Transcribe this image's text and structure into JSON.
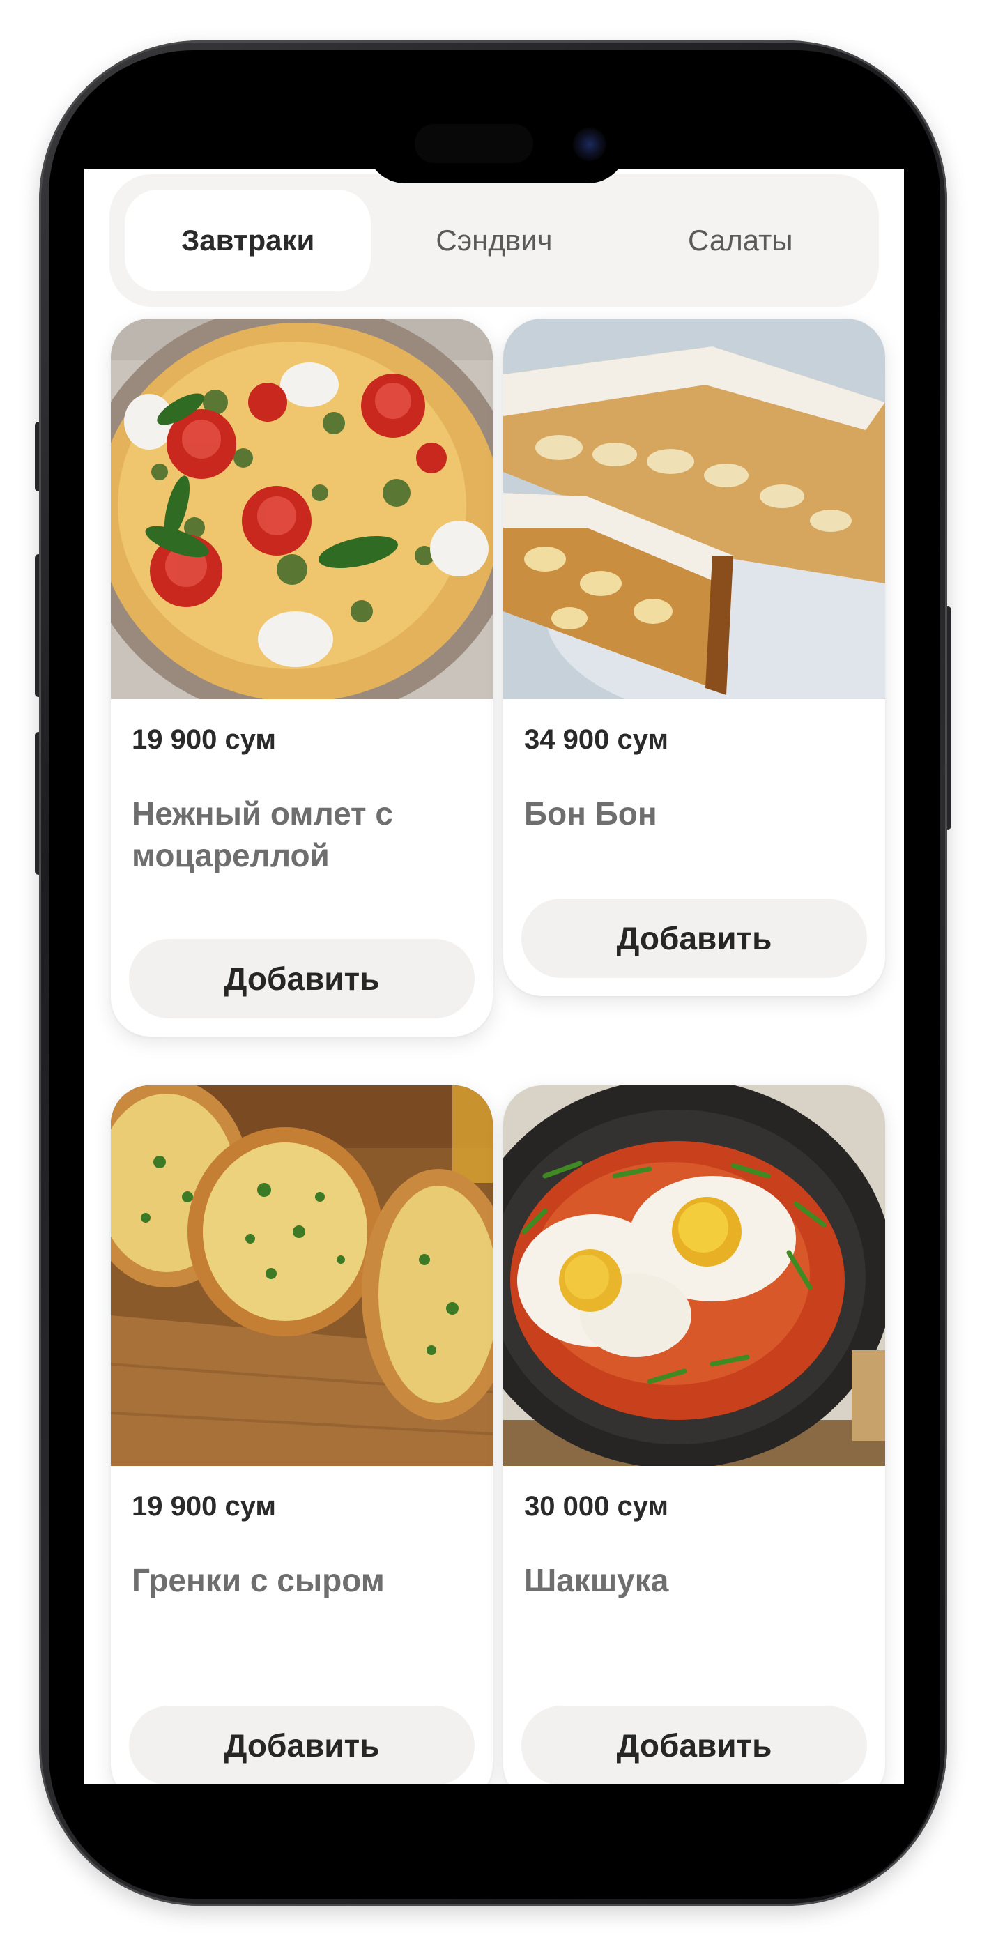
{
  "categories": {
    "tabs": [
      {
        "label": "Завтраки",
        "active": true
      },
      {
        "label": "Сэндвич",
        "active": false
      },
      {
        "label": "Салаты",
        "active": false
      }
    ]
  },
  "products": [
    {
      "price": "19 900 сум",
      "title": "Нежный омлет с моцареллой",
      "button": "Добавить",
      "image": "omelette-with-mozzarella-photo"
    },
    {
      "price": "34 900 сум",
      "title": "Бон Бон",
      "button": "Добавить",
      "image": "bon-bon-pastry-photo"
    },
    {
      "price": "19 900 сум",
      "title": "Гренки с сыром",
      "button": "Добавить",
      "image": "cheese-toast-photo"
    },
    {
      "price": "30 000 сум",
      "title": "Шакшука",
      "button": "Добавить",
      "image": "shakshuka-photo"
    }
  ],
  "colors": {
    "tab_bar_bg": "#f4f3f1",
    "active_tab_bg": "#ffffff",
    "button_bg": "#f2f1ef",
    "price_text": "#2a2a2a",
    "title_text": "#6e6e6e",
    "frame": "#1d1d1f"
  }
}
